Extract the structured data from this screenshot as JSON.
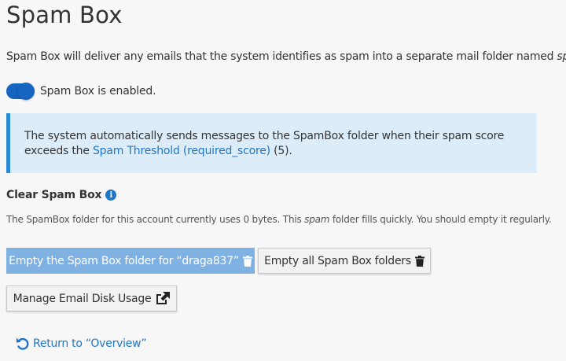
{
  "page": {
    "title": "Spam Box",
    "description_before": "Spam Box will deliver any emails that the system identifies as spam into a separate mail folder named ",
    "description_em": "spam",
    "description_after": "."
  },
  "toggle": {
    "label": "Spam Box is enabled.",
    "enabled": true,
    "color": "#1565c0"
  },
  "info": {
    "text_before": "The system automatically sends messages to the SpamBox folder when their spam score exceeds the ",
    "link_text": "Spam Threshold (required_score)",
    "text_after": " (5)."
  },
  "clear_section": {
    "title": "Clear Spam Box",
    "icon": "info-icon",
    "note_before": "The SpamBox folder for this account currently uses 0 bytes. This ",
    "note_em": "spam",
    "note_after": " folder fills quickly. You should empty it regularly."
  },
  "buttons": {
    "empty_user": "Empty the Spam Box folder for “draga837”",
    "empty_all": "Empty all Spam Box folders",
    "manage_disk": "Manage Email Disk Usage"
  },
  "return_link": {
    "label": "Return to “Overview”"
  },
  "colors": {
    "primary": "#7fb2e3",
    "link": "#1f76c8",
    "info_bg": "#dcecf8",
    "info_border": "#2a8bd6"
  }
}
